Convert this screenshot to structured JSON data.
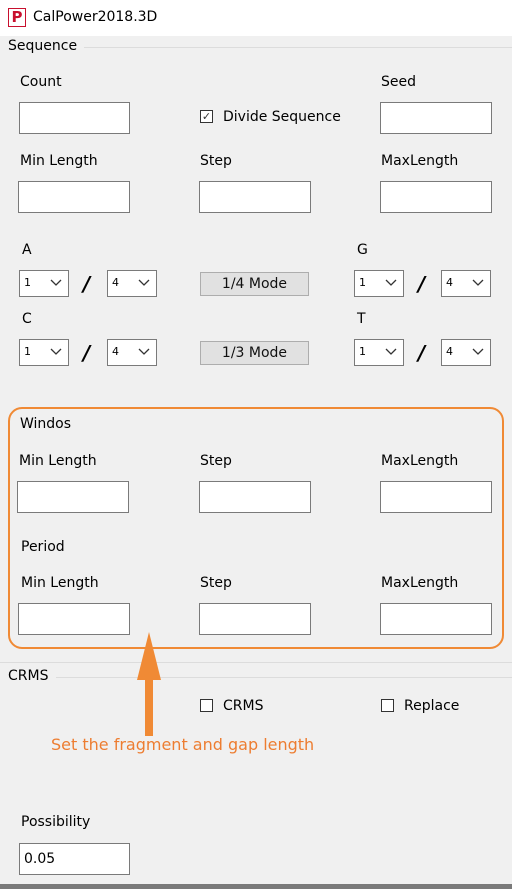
{
  "window": {
    "title": "CalPower2018.3D",
    "icon_letter": "P"
  },
  "sequence": {
    "group_label": "Sequence",
    "count_label": "Count",
    "count_value": "",
    "divide_sequence_label": "Divide Sequence",
    "divide_sequence_checked": true,
    "seed_label": "Seed",
    "seed_value": "",
    "min_length_label": "Min Length",
    "min_length_value": "",
    "step_label": "Step",
    "step_value": "",
    "max_length_label": "MaxLength",
    "max_length_value": "",
    "a_label": "A",
    "a_num": "1",
    "a_den": "4",
    "g_label": "G",
    "g_num": "1",
    "g_den": "4",
    "c_label": "C",
    "c_num": "1",
    "c_den": "4",
    "t_label": "T",
    "t_num": "1",
    "t_den": "4",
    "slash": "/",
    "mode_quarter_label": "1/4 Mode",
    "mode_third_label": "1/3 Mode"
  },
  "windos": {
    "label": "Windos",
    "min_length_label": "Min Length",
    "min_length_value": "",
    "step_label": "Step",
    "step_value": "",
    "max_length_label": "MaxLength",
    "max_length_value": ""
  },
  "period": {
    "label": "Period",
    "min_length_label": "Min Length",
    "min_length_value": "",
    "step_label": "Step",
    "step_value": "",
    "max_length_label": "MaxLength",
    "max_length_value": ""
  },
  "crms": {
    "group_label": "CRMS",
    "crms_checkbox_label": "CRMS",
    "crms_checked": false,
    "replace_checkbox_label": "Replace",
    "replace_checked": false
  },
  "annotation": {
    "text": "Set the fragment and gap length",
    "color": "#ed7d31"
  },
  "possibility": {
    "label": "Possibility",
    "value": "0.05"
  },
  "icons": {
    "dropdown": "chevron-down-icon",
    "arrow": "arrow-up-icon"
  }
}
